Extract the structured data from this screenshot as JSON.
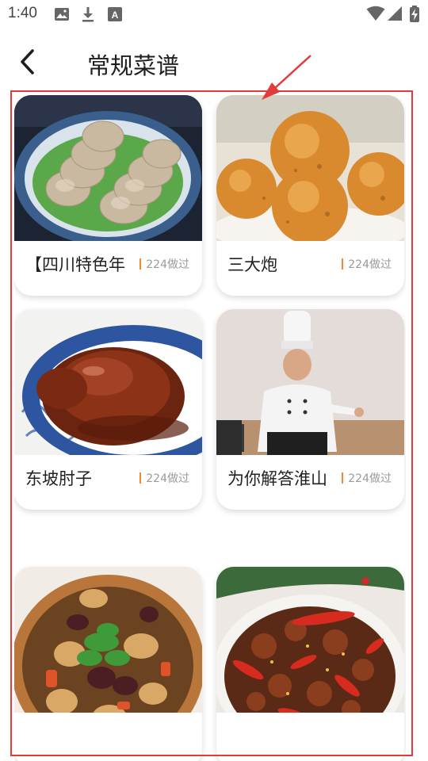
{
  "status_bar": {
    "time": "1:40",
    "left_icons": [
      "image-icon",
      "download-icon",
      "a-square-icon"
    ],
    "right_icons": [
      "wifi-icon",
      "signal-icon",
      "battery-charging-icon"
    ]
  },
  "header": {
    "back_icon": "chevron-left-icon",
    "title": "常规菜谱"
  },
  "recipes": [
    {
      "title": "【四川特色年",
      "made_count": "224做过",
      "photo": "sliced meatloaf on lettuce"
    },
    {
      "title": "三大炮",
      "made_count": "224做过",
      "photo": "golden fried sesame balls"
    },
    {
      "title": "东坡肘子",
      "made_count": "224做过",
      "photo": "braised pork knuckle"
    },
    {
      "title": "为你解答淮山",
      "made_count": "224做过",
      "photo": "chef in white uniform"
    },
    {
      "title": "",
      "made_count": "",
      "photo": "braised stew in clay pot"
    },
    {
      "title": "",
      "made_count": "",
      "photo": "spicy chicken with chilies"
    }
  ],
  "colors": {
    "annotation": "#e23b3b",
    "accent_bar": "#f08a30",
    "count_text": "#9a9a9a"
  }
}
